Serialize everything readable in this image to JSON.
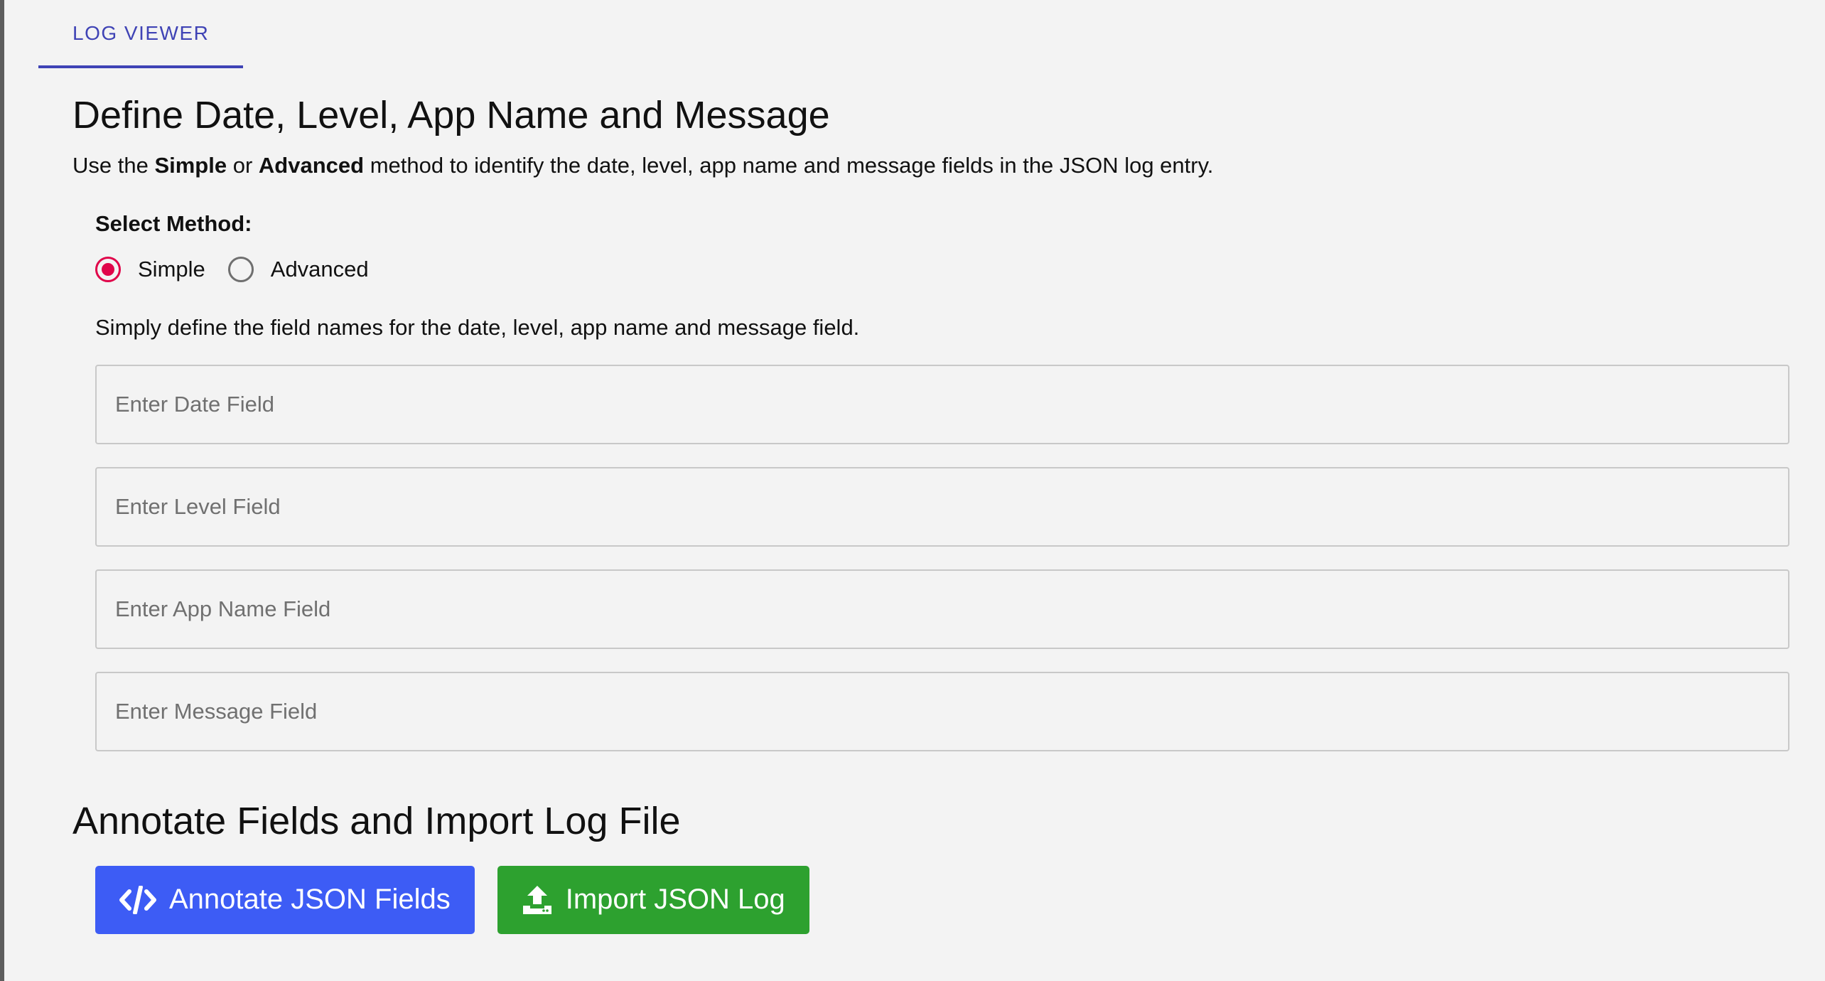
{
  "tabs": [
    {
      "label": "LOG VIEWER",
      "active": true
    }
  ],
  "main": {
    "title": "Define Date, Level, App Name and Message",
    "intro": {
      "prefix": "Use the ",
      "bold1": "Simple",
      "mid": " or ",
      "bold2": "Advanced",
      "suffix": " method to identify the date, level, app name and message fields in the JSON log entry."
    },
    "method_label": "Select Method:",
    "methods": [
      {
        "label": "Simple",
        "selected": true
      },
      {
        "label": "Advanced",
        "selected": false
      }
    ],
    "helper": "Simply define the field names for the date, level, app name and message field.",
    "fields": {
      "date": {
        "placeholder": "Enter Date Field",
        "value": ""
      },
      "level": {
        "placeholder": "Enter Level Field",
        "value": ""
      },
      "app_name": {
        "placeholder": "Enter App Name Field",
        "value": ""
      },
      "message": {
        "placeholder": "Enter Message Field",
        "value": ""
      }
    }
  },
  "annotate": {
    "title": "Annotate Fields and Import Log File",
    "annotate_button": {
      "label": "Annotate JSON Fields",
      "icon": "code-icon",
      "color": "#3d5cf5"
    },
    "import_button": {
      "label": "Import JSON Log",
      "icon": "upload-icon",
      "color": "#2da12f"
    }
  },
  "colors": {
    "accent": "#3f43b5",
    "radio_selected": "#e0054a"
  }
}
